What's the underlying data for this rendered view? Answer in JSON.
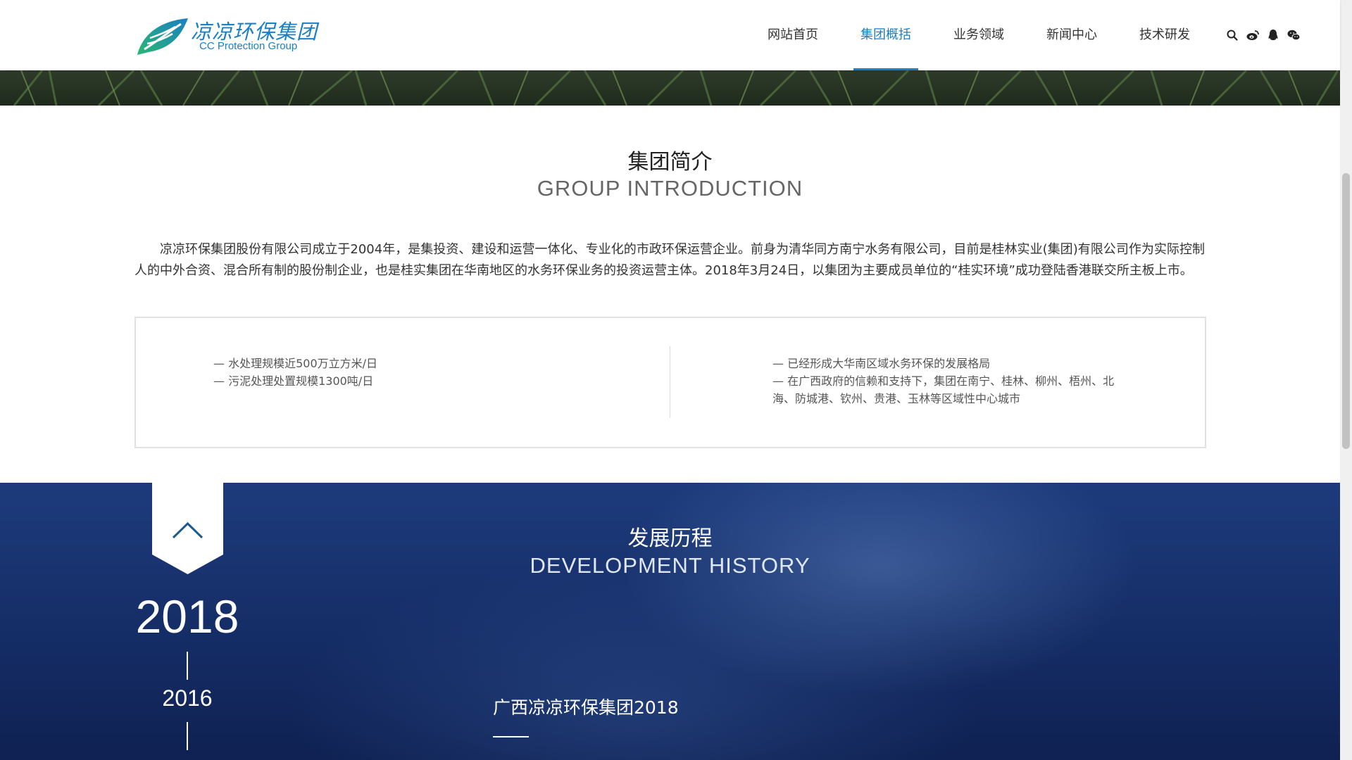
{
  "header": {
    "logo": {
      "name_cn": "凉凉环保集团",
      "name_en": "CC Protection Group"
    },
    "nav": [
      {
        "label": "网站首页",
        "active": false
      },
      {
        "label": "集团概括",
        "active": true
      },
      {
        "label": "业务领域",
        "active": false
      },
      {
        "label": "新闻中心",
        "active": false
      },
      {
        "label": "技术研发",
        "active": false
      }
    ],
    "icons": [
      "search-icon",
      "weibo-icon",
      "qq-icon",
      "wechat-icon"
    ]
  },
  "intro": {
    "title": "集团简介",
    "subtitle": "GROUP INTRODUCTION",
    "body": "凉凉环保集团股份有限公司成立于2004年，是集投资、建设和运营一体化、专业化的市政环保运营企业。前身为清华同方南宁水务有限公司，目前是桂林实业(集团)有限公司作为实际控制人的中外合资、混合所有制的股份制企业，也是桂实集团在华南地区的水务环保业务的投资运营主体。2018年3月24日，以集团为主要成员单位的“桂实环境”成功登陆香港联交所主板上市。",
    "stats_left": [
      "— 水处理规模近500万立方米/日",
      "— 污泥处理处置规模1300吨/日"
    ],
    "stats_right": [
      "— 已经形成大华南区域水务环保的发展格局",
      "— 在广西政府的信赖和支持下，集团在南宁、桂林、柳州、梧州、北海、防城港、钦州、贵港、玉林等区域性中心城市"
    ]
  },
  "history": {
    "title": "发展历程",
    "subtitle": "DEVELOPMENT HISTORY",
    "current_year": "2018",
    "next_year": "2016",
    "heading": "广西凉凉环保集团2018"
  },
  "colors": {
    "accent": "#1a7fc4",
    "history_bg": "#1a3672",
    "logo_green": "#2bb673"
  }
}
